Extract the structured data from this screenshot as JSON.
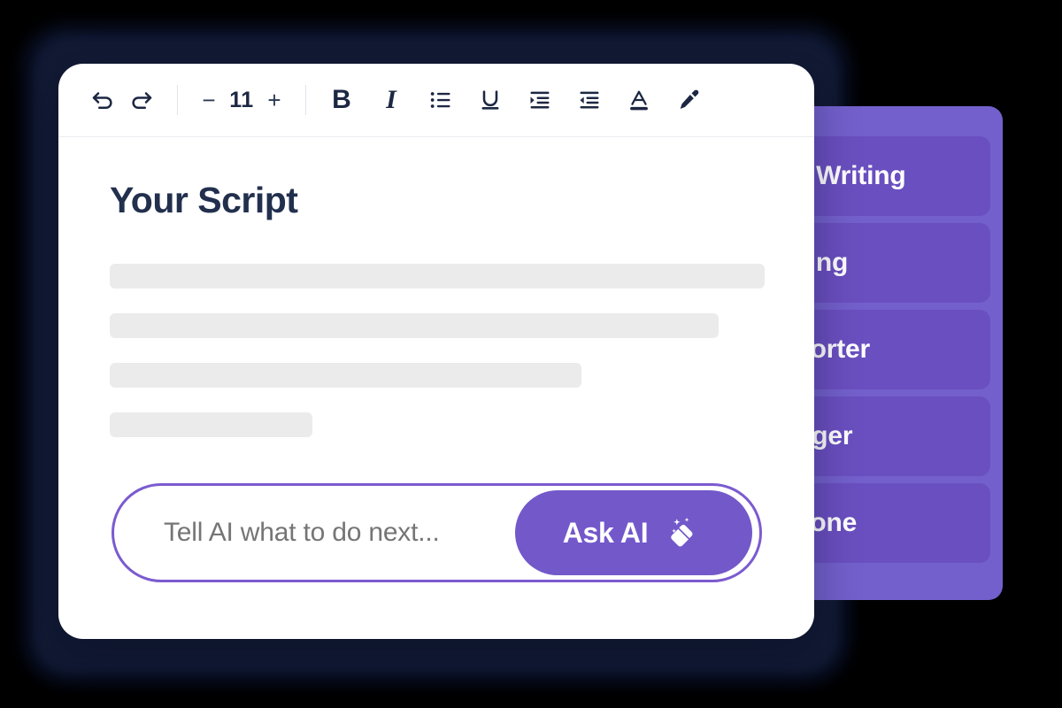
{
  "theme": {
    "backdrop": "#000000",
    "plate": "#0e1630",
    "card_bg": "#ffffff",
    "accent_purple": "#7358ca",
    "panel_purple": "#7360cc",
    "panel_item_purple": "#6a4fc0",
    "ink": "#1c2742",
    "title_ink": "#22304e",
    "placeholder": "#b3a4e0",
    "skeleton": "#ebebeb"
  },
  "toolbar": {
    "history": [
      {
        "name": "undo",
        "label": "Undo",
        "icon": "undo-icon"
      },
      {
        "name": "redo",
        "label": "Redo",
        "icon": "redo-icon"
      }
    ],
    "font_size": {
      "decrease_label": "−",
      "value": "11",
      "increase_label": "+"
    },
    "format": [
      {
        "name": "bold",
        "label": "B",
        "icon": "bold-icon"
      },
      {
        "name": "italic",
        "label": "I",
        "icon": "italic-icon"
      },
      {
        "name": "bullet-list",
        "label": "Bullet list",
        "icon": "bullet-list-icon"
      },
      {
        "name": "underline",
        "label": "U",
        "icon": "underline-icon"
      },
      {
        "name": "indent-increase",
        "label": "Increase indent",
        "icon": "indent-increase-icon"
      },
      {
        "name": "indent-decrease",
        "label": "Decrease indent",
        "icon": "indent-decrease-icon"
      },
      {
        "name": "text-color",
        "label": "A",
        "icon": "text-color-icon"
      },
      {
        "name": "highlight",
        "label": "Highlight",
        "icon": "highlighter-icon"
      }
    ]
  },
  "document": {
    "title": "Your Script",
    "skeleton_widths": [
      "100%",
      "93%",
      "72%",
      "31%"
    ]
  },
  "ai_bar": {
    "placeholder": "Tell AI what to do next...",
    "value": "",
    "button_label": "Ask AI",
    "button_icon": "magic-wand-icon"
  },
  "actions_panel": {
    "items": [
      {
        "label": "Improve Writing",
        "visible_text": "ve Writing"
      },
      {
        "label": "Fix Spelling",
        "visible_text": "elling"
      },
      {
        "label": "Make shorter",
        "visible_text": "shorter"
      },
      {
        "label": "Make longer",
        "visible_text": "onger"
      },
      {
        "label": "Change tone",
        "visible_text": "e tone"
      }
    ]
  }
}
